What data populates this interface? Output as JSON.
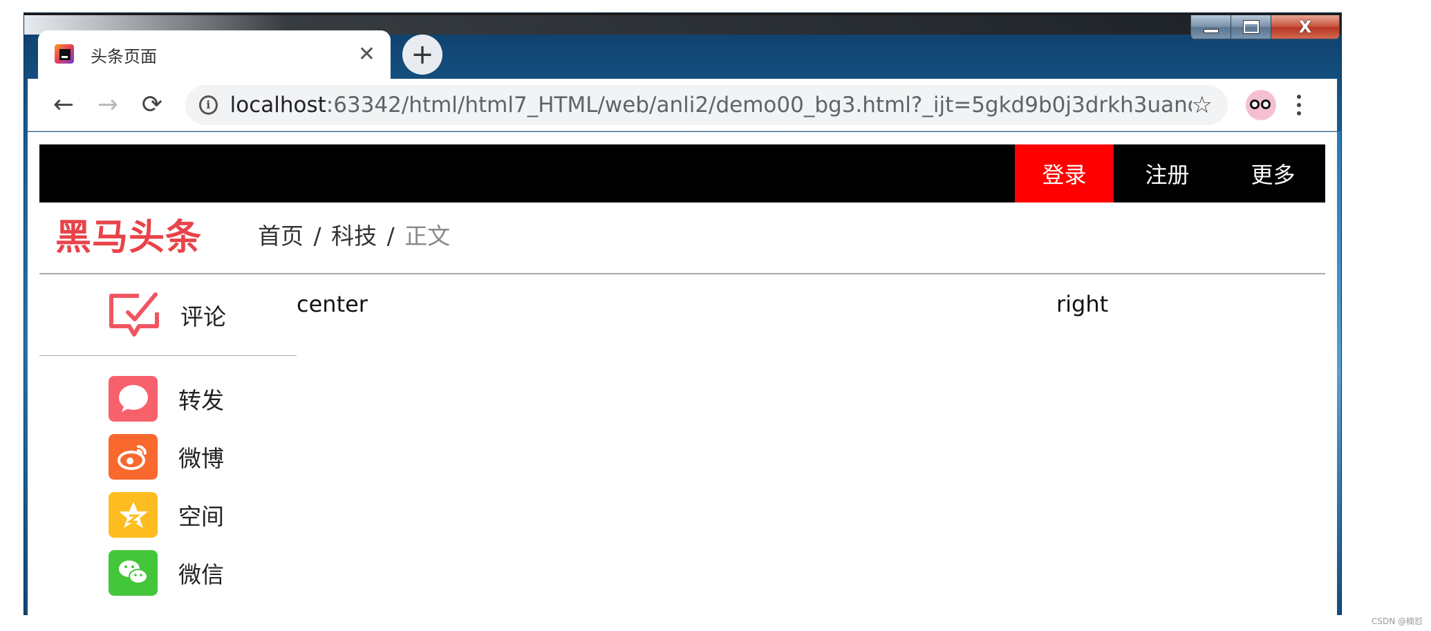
{
  "browser": {
    "tab": {
      "title": "头条页面",
      "close_glyph": "✕",
      "favicon_icon": "jetbrains-logo-icon"
    },
    "new_tab_glyph": "+",
    "nav": {
      "back_glyph": "←",
      "forward_glyph": "→",
      "reload_glyph": "⟳"
    },
    "address": {
      "info_glyph": "i",
      "host": "localhost",
      "rest": ":63342/html/html7_HTML/web/anli2/demo00_bg3.html?_ijt=5gkd9b0j3drkh3uano61..."
    },
    "star_glyph": "☆",
    "window_controls": {
      "close_glyph": "X"
    }
  },
  "page": {
    "topbar": {
      "login": "登录",
      "register": "注册",
      "more": "更多",
      "login_bg": "#ff0000",
      "bar_bg": "#000000"
    },
    "logo": "黑马头条",
    "logo_color": "#e8434a",
    "breadcrumb": {
      "home": "首页",
      "sep1": "/",
      "tech": "科技",
      "sep2": "/",
      "current": "正文"
    },
    "left": {
      "comment_label": "评论",
      "share_items": [
        {
          "label": "转发",
          "icon": "repost-bubble-icon",
          "color": "#f7616b"
        },
        {
          "label": "微博",
          "icon": "weibo-icon",
          "color": "#f9692e"
        },
        {
          "label": "空间",
          "icon": "qzone-star-icon",
          "color": "#fdbc1f"
        },
        {
          "label": "微信",
          "icon": "wechat-icon",
          "color": "#43c639"
        }
      ]
    },
    "center_label": "center",
    "right_label": "right"
  },
  "watermark": "CSDN @楠怼"
}
